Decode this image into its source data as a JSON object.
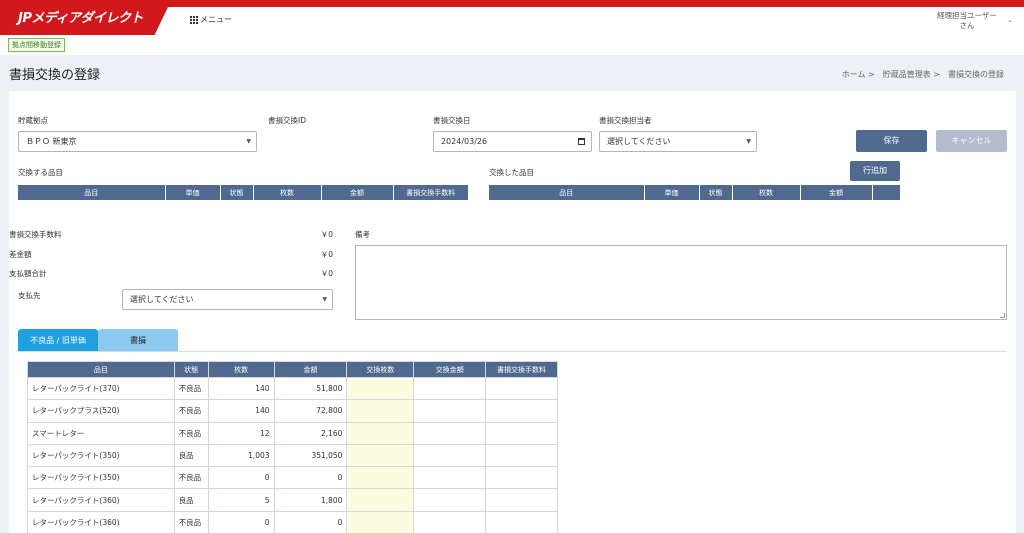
{
  "header": {
    "logo": "JPメディアダイレクト",
    "menu_label": "メニュー",
    "user_line1": "経理担当ユーザー",
    "user_line2": "さん"
  },
  "sub_badge": "拠点間移動登録",
  "page": {
    "title": "書損交換の登録",
    "breadcrumb": "ホーム >　貯蔵品管理表 >　書損交換の登録"
  },
  "form": {
    "storage_label": "貯蔵拠点",
    "storage_value": "ＢＰＯ 新東京",
    "exchange_id_label": "書損交換ID",
    "exchange_date_label": "書損交換日",
    "exchange_date_value": "2024/03/26",
    "staff_label": "書損交換担当者",
    "staff_value": "選択してください",
    "save_button": "保存",
    "cancel_button": "キャンセル"
  },
  "exchange_items": {
    "label": "交換する品目",
    "columns": [
      "品目",
      "単価",
      "状態",
      "枚数",
      "金額",
      "書損交換手数料"
    ]
  },
  "exchanged_items": {
    "label": "交換した品目",
    "add_row_button": "行追加",
    "columns": [
      "品目",
      "単価",
      "状態",
      "枚数",
      "金額",
      ""
    ]
  },
  "summary": {
    "fee_label": "書損交換手数料",
    "fee_value": "￥0",
    "diff_label": "差金額",
    "diff_value": "￥0",
    "total_label": "支払額合計",
    "total_value": "￥0",
    "payee_label": "支払先",
    "payee_value": "選択してください",
    "remarks_label": "備考"
  },
  "tabs": [
    {
      "label": "不良品 / 旧単価"
    },
    {
      "label": "書損"
    }
  ],
  "inventory": {
    "columns": [
      "品目",
      "状態",
      "枚数",
      "金額",
      "交換枚数",
      "交換金額",
      "書損交換手数料"
    ],
    "rows": [
      {
        "item": "レターパックライト(370)",
        "state": "不良品",
        "count": "140",
        "amount": "51,800"
      },
      {
        "item": "レターパックプラス(520)",
        "state": "不良品",
        "count": "140",
        "amount": "72,800"
      },
      {
        "item": "スマートレター",
        "state": "不良品",
        "count": "12",
        "amount": "2,160"
      },
      {
        "item": "レターパックライト(350)",
        "state": "良品",
        "count": "1,003",
        "amount": "351,050"
      },
      {
        "item": "レターパックライト(350)",
        "state": "不良品",
        "count": "0",
        "amount": "0"
      },
      {
        "item": "レターパックライト(360)",
        "state": "良品",
        "count": "5",
        "amount": "1,800"
      },
      {
        "item": "レターパックライト(360)",
        "state": "不良品",
        "count": "0",
        "amount": "0"
      }
    ]
  }
}
